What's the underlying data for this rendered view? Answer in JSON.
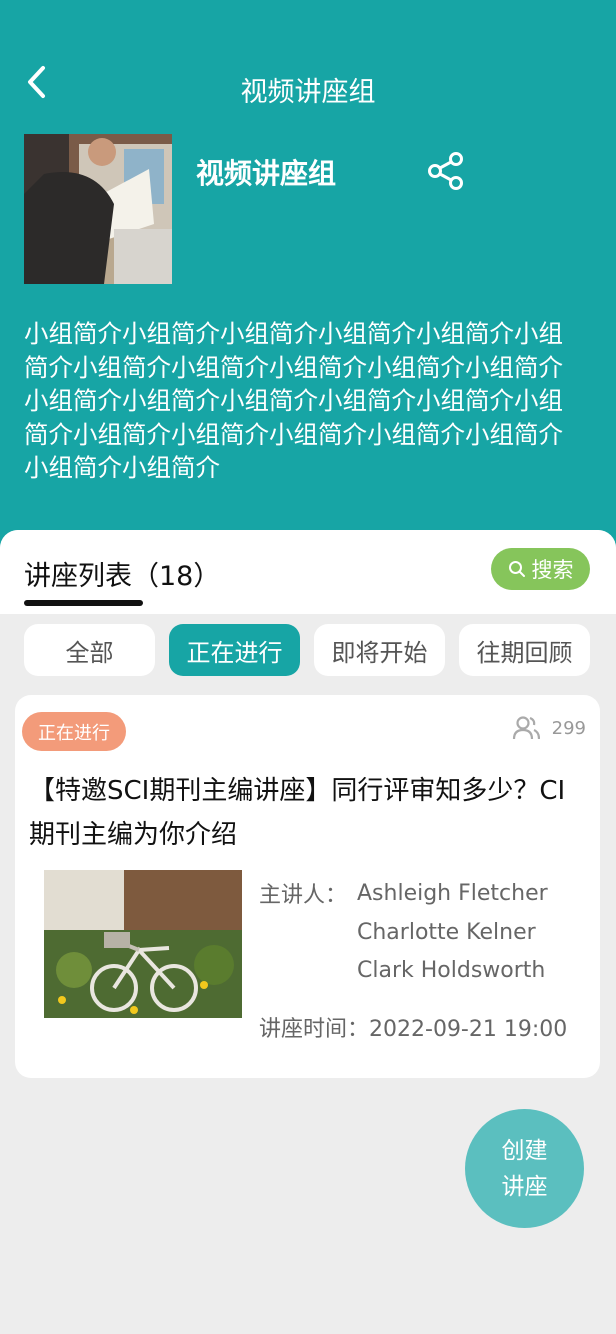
{
  "nav": {
    "title": "视频讲座组",
    "back_icon": "chevron-left-icon"
  },
  "group": {
    "name": "视频讲座组",
    "share_icon": "share-icon",
    "intro": "小组简介小组简介小组简介小组简介小组简介小组简介小组简介小组简介小组简介小组简介小组简介小组简介小组简介小组简介小组简介小组简介小组简介小组简介小组简介小组简介小组简介小组简介小组简介小组简介"
  },
  "list": {
    "title": "讲座列表（18）",
    "search_label": "搜索",
    "tabs": [
      "全部",
      "正在进行",
      "即将开始",
      "往期回顾"
    ],
    "active_tab": "正在进行"
  },
  "card": {
    "status": "正在进行",
    "viewers": "299",
    "title": "【特邀SCI期刊主编讲座】同行评审知多少？CI期刊主编为你介绍",
    "speaker_label": "主讲人：",
    "speakers": [
      "Ashleigh Fletcher",
      "Charlotte Kelner",
      "Clark Holdsworth"
    ],
    "time_label": "讲座时间：",
    "time": "2022-09-21 19:00"
  },
  "fab": {
    "label": "创建讲座"
  },
  "colors": {
    "primary": "#17a5a5",
    "search": "#86c55b",
    "status_badge": "#f39b7a",
    "fab": "#5bbfbf"
  }
}
